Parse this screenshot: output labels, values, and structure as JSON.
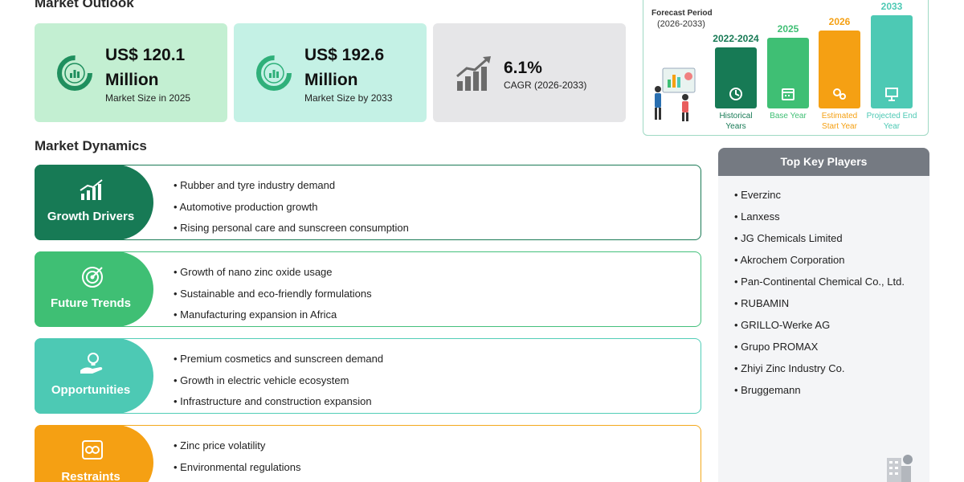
{
  "outlook": {
    "title": "Market Outlook",
    "cards": [
      {
        "value": "US$ 120.1 Million",
        "label": "Market Size in 2025",
        "icon": "donut-chart-icon"
      },
      {
        "value": "US$ 192.6 Million",
        "label": "Market Size by 2033",
        "icon": "donut-chart-icon"
      },
      {
        "value": "6.1%",
        "label": "CAGR (2026-2033)",
        "icon": "growth-bars-icon"
      }
    ]
  },
  "forecast": {
    "label": "Forecast Period",
    "range": "(2026-2033)",
    "bars": [
      {
        "year": "2022-2024",
        "caption": "Historical Years",
        "color": "#177a55",
        "icon": "history-icon"
      },
      {
        "year": "2025",
        "caption": "Base Year",
        "color": "#3fbf74",
        "icon": "calendar-icon"
      },
      {
        "year": "2026",
        "caption": "Estimated Start Year",
        "color": "#f5a013",
        "icon": "gears-icon"
      },
      {
        "year": "2033",
        "caption": "Projected End Year",
        "color": "#4dc9b4",
        "icon": "presentation-icon"
      }
    ]
  },
  "dynamics": {
    "title": "Market Dynamics",
    "rows": [
      {
        "label": "Growth Drivers",
        "icon": "rising-chart-icon",
        "items": [
          "Rubber and tyre industry demand",
          "Automotive production growth",
          "Rising personal care and sunscreen consumption"
        ]
      },
      {
        "label": "Future Trends",
        "icon": "target-icon",
        "items": [
          "Growth of nano zinc oxide usage",
          "Sustainable and eco-friendly formulations",
          "Manufacturing expansion in Africa"
        ]
      },
      {
        "label": "Opportunities",
        "icon": "lightbulb-hand-icon",
        "items": [
          "Premium cosmetics and sunscreen demand",
          "Growth in electric vehicle ecosystem",
          "Infrastructure and construction expansion"
        ]
      },
      {
        "label": "Restraints",
        "icon": "restraint-icon",
        "items": [
          "Zinc price volatility",
          "Environmental regulations"
        ]
      }
    ]
  },
  "players": {
    "title": "Top Key Players",
    "items": [
      "Everzinc",
      "Lanxess",
      "JG Chemicals Limited",
      "Akrochem Corporation",
      "Pan-Continental Chemical Co., Ltd.",
      "RUBAMIN",
      "GRILLO-Werke AG",
      "Grupo PROMAX",
      "Zhiyi Zinc Industry Co.",
      "Bruggemann"
    ]
  }
}
